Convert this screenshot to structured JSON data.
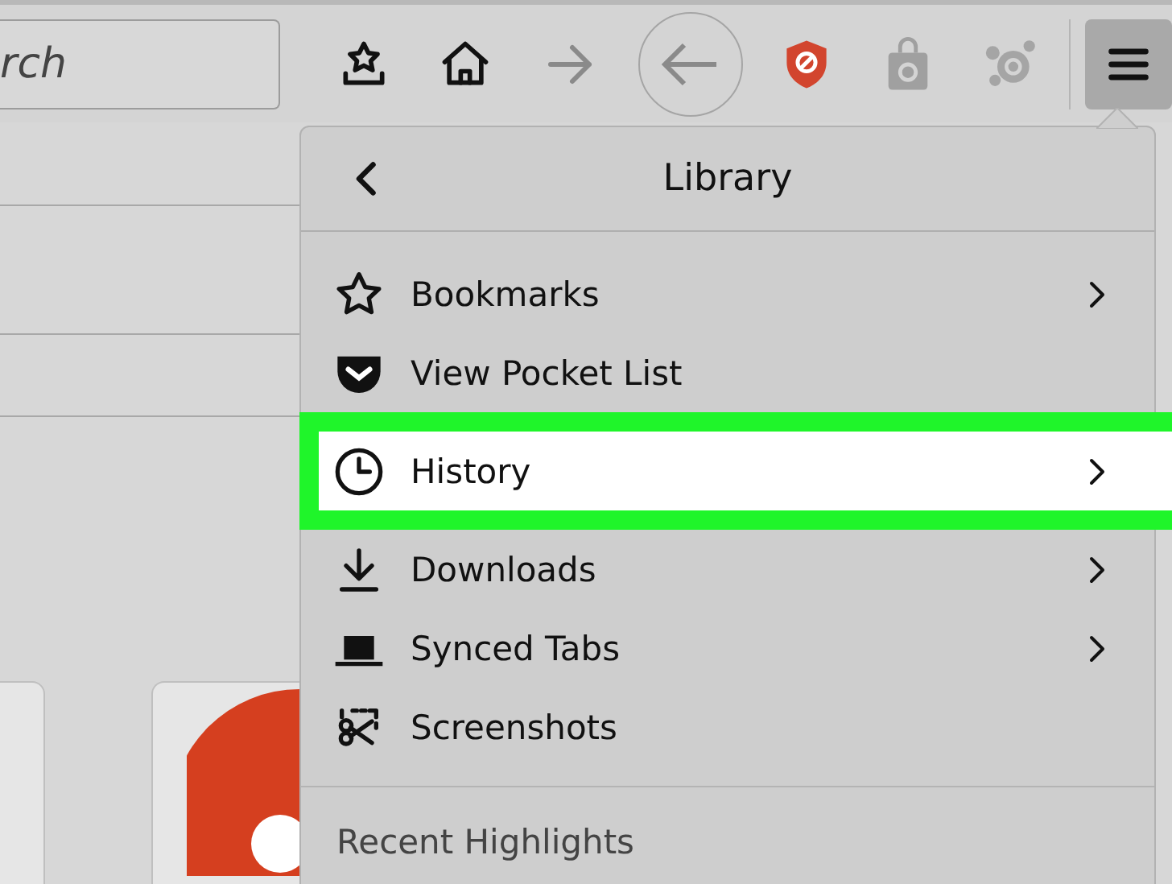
{
  "search": {
    "value": "rch"
  },
  "toolbar": [
    {
      "kind": "save"
    },
    {
      "kind": "home"
    },
    {
      "kind": "forward"
    },
    {
      "kind": "back"
    },
    {
      "kind": "shield"
    },
    {
      "kind": "bag"
    },
    {
      "kind": "splat"
    }
  ],
  "menu_button": {
    "pressed": true
  },
  "library": {
    "title": "Library",
    "items": [
      {
        "kind": "star",
        "label": "Bookmarks",
        "submenu": true,
        "selected": false
      },
      {
        "kind": "pocket",
        "label": "View Pocket List",
        "submenu": false,
        "selected": false
      },
      {
        "kind": "clock",
        "label": "History",
        "submenu": true,
        "selected": true
      },
      {
        "kind": "download",
        "label": "Downloads",
        "submenu": true,
        "selected": false
      },
      {
        "kind": "synced",
        "label": "Synced Tabs",
        "submenu": true,
        "selected": false
      },
      {
        "kind": "screenshot",
        "label": "Screenshots",
        "submenu": false,
        "selected": false
      }
    ],
    "section": "Recent Highlights"
  }
}
